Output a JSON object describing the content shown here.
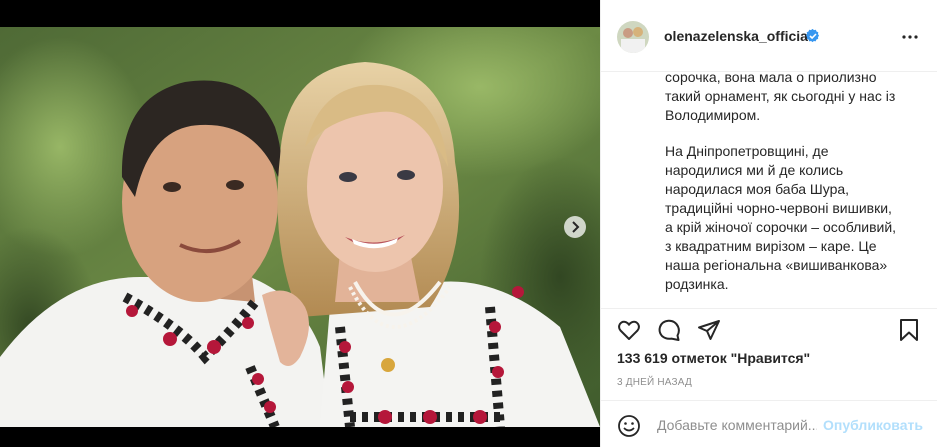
{
  "post": {
    "username": "olenazelenska_official",
    "verified": true,
    "caption_lines": [
      "сорочка, вона мала о приолизно",
      "такий орнамент, як сьогодні у нас із",
      "Володимиром.",
      "",
      "На Дніпропетровщині, де",
      "народилися ми й де колись",
      "народилася моя баба Шура,",
      "традиційні чорно-червоні вишивки,",
      "а крій жіночої сорочки – особливий,",
      "з квадратним вирізом – каре. Це",
      "наша регіональна «вишиванкова»",
      "родзинка."
    ],
    "likes_text": "133 619 отметок \"Нравится\"",
    "timestamp": "3 ДНЕЙ НАЗАД"
  },
  "comment": {
    "placeholder": "Добавьте комментарий...",
    "post_label": "Опубликовать"
  },
  "icons": {
    "verified": "verified-badge-icon",
    "more": "more-options-icon",
    "like": "heart-icon",
    "comment": "comment-icon",
    "share": "share-icon",
    "save": "bookmark-icon",
    "emoji": "emoji-icon",
    "next": "chevron-right-icon"
  },
  "colors": {
    "verified_blue": "#3897f0",
    "post_button_disabled": "#b2dffc",
    "secondary_text": "#8e8e8e",
    "embroidery_red": "#b5173a"
  }
}
